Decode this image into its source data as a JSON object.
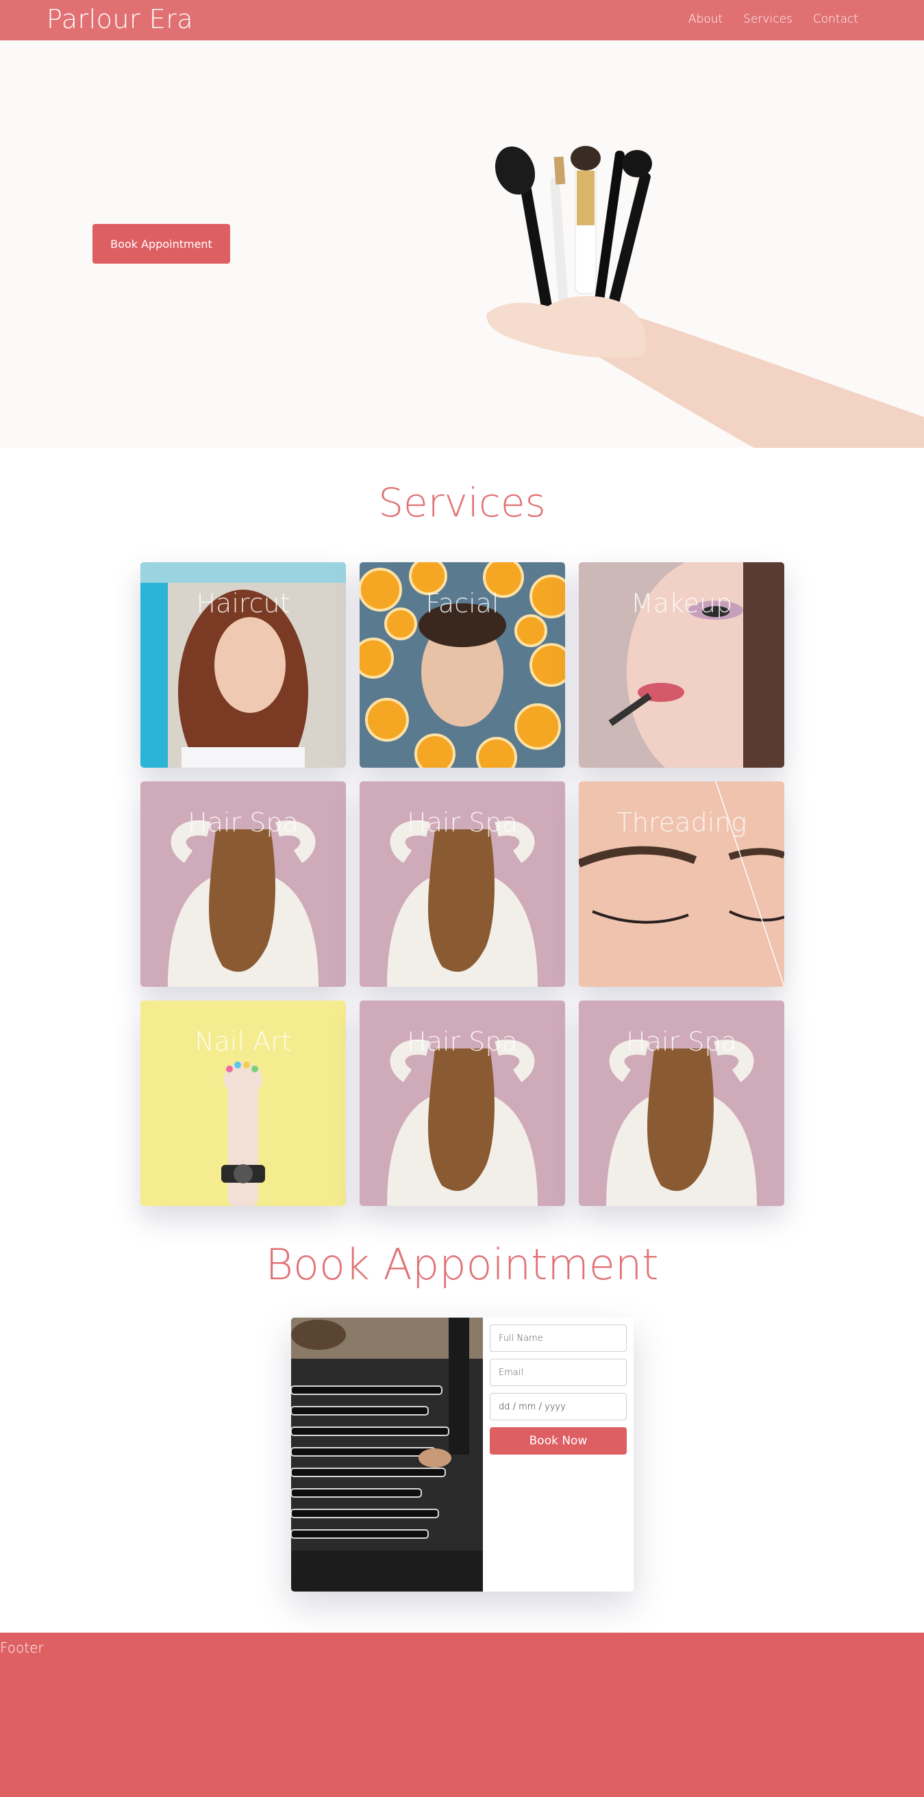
{
  "nav": {
    "brand": "Parlour Era",
    "links": [
      "About",
      "Services",
      "Contact"
    ]
  },
  "hero": {
    "button_label": "Book Appointment",
    "image": "makeup-brushes-in-hand"
  },
  "services": {
    "title": "Services",
    "cards": [
      {
        "label": "Haircut",
        "image": "woman-red-hair"
      },
      {
        "label": "Facial",
        "image": "face-in-citrus-slices"
      },
      {
        "label": "Makeup",
        "image": "lipstick-application"
      },
      {
        "label": "Hair Spa",
        "image": "woman-wavy-hair-back"
      },
      {
        "label": "Hair Spa",
        "image": "woman-wavy-hair-back"
      },
      {
        "label": "Threading",
        "image": "closed-eye-closeup"
      },
      {
        "label": "Nail Art",
        "image": "hand-painted-nails-yellow-wall"
      },
      {
        "label": "Hair Spa",
        "image": "woman-wavy-hair-back"
      },
      {
        "label": "Hair Spa",
        "image": "woman-wavy-hair-back"
      }
    ]
  },
  "booking": {
    "title": "Book Appointment",
    "image": "makeup-brush-roll",
    "name_placeholder": "Full Name",
    "email_placeholder": "Email",
    "date_placeholder": "dd / mm / yyyy",
    "submit_label": "Book Now"
  },
  "footer": {
    "label": "Footer"
  },
  "colors": {
    "accent": "#e07072",
    "button": "#de5f62",
    "title": "#e07174"
  }
}
